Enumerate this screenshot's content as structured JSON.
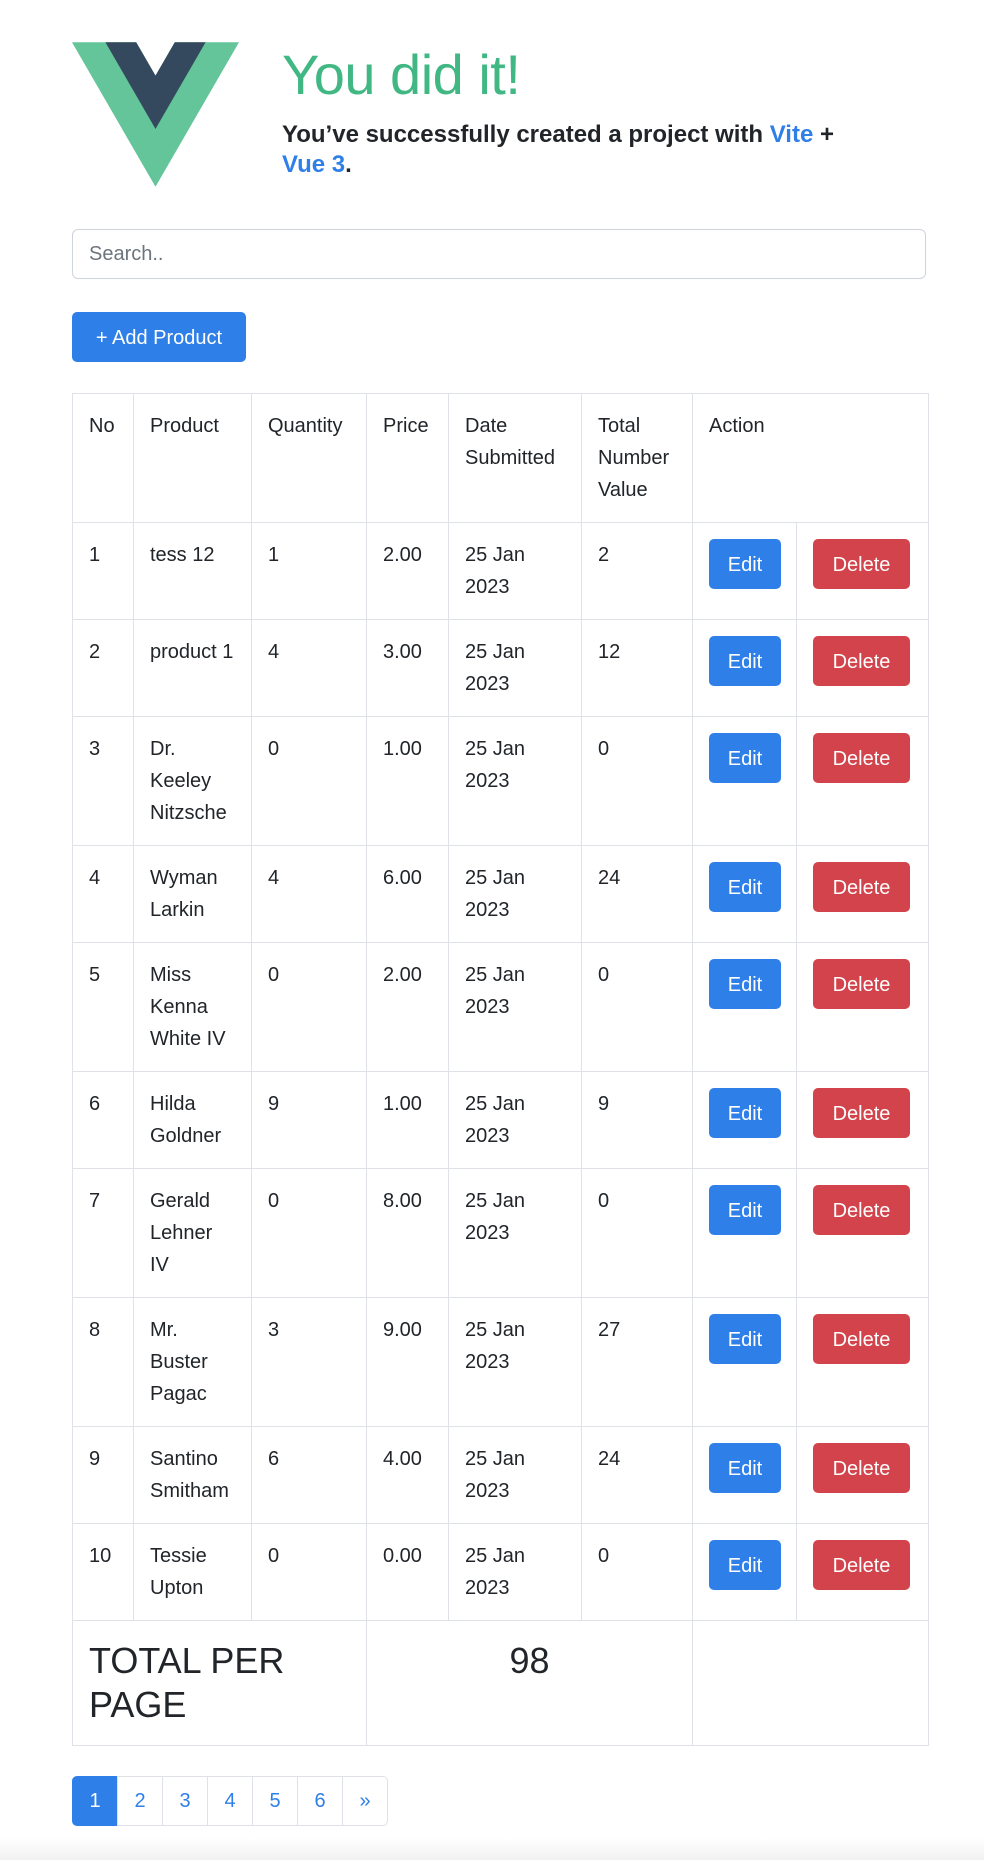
{
  "header": {
    "title": "You did it!",
    "subtitle_prefix": "You’ve successfully created a project with ",
    "link_vite": "Vite",
    "subtitle_mid": " + ",
    "link_vue": "Vue 3",
    "subtitle_suffix": ".",
    "logo_icon": "vue-logo-icon",
    "colors": {
      "vue_green": "#41b883",
      "vue_dark": "#35495e"
    }
  },
  "search": {
    "placeholder": "Search..",
    "value": ""
  },
  "toolbar": {
    "add_label": "+ Add Product"
  },
  "table": {
    "columns": [
      "No",
      "Product",
      "Quantity",
      "Price",
      "Date Submitted",
      "Total Number Value",
      "Action"
    ],
    "rows": [
      {
        "no": "1",
        "product": "tess 12",
        "quantity": "1",
        "price": "2.00",
        "date": "25 Jan 2023",
        "total": "2",
        "edit": "Edit",
        "delete": "Delete"
      },
      {
        "no": "2",
        "product": "product 1",
        "quantity": "4",
        "price": "3.00",
        "date": "25 Jan 2023",
        "total": "12",
        "edit": "Edit",
        "delete": "Delete"
      },
      {
        "no": "3",
        "product": "Dr. Keeley Nitzsche",
        "quantity": "0",
        "price": "1.00",
        "date": "25 Jan 2023",
        "total": "0",
        "edit": "Edit",
        "delete": "Delete"
      },
      {
        "no": "4",
        "product": "Wyman Larkin",
        "quantity": "4",
        "price": "6.00",
        "date": "25 Jan 2023",
        "total": "24",
        "edit": "Edit",
        "delete": "Delete"
      },
      {
        "no": "5",
        "product": "Miss Kenna White IV",
        "quantity": "0",
        "price": "2.00",
        "date": "25 Jan 2023",
        "total": "0",
        "edit": "Edit",
        "delete": "Delete"
      },
      {
        "no": "6",
        "product": "Hilda Goldner",
        "quantity": "9",
        "price": "1.00",
        "date": "25 Jan 2023",
        "total": "9",
        "edit": "Edit",
        "delete": "Delete"
      },
      {
        "no": "7",
        "product": "Gerald Lehner IV",
        "quantity": "0",
        "price": "8.00",
        "date": "25 Jan 2023",
        "total": "0",
        "edit": "Edit",
        "delete": "Delete"
      },
      {
        "no": "8",
        "product": "Mr. Buster Pagac",
        "quantity": "3",
        "price": "9.00",
        "date": "25 Jan 2023",
        "total": "27",
        "edit": "Edit",
        "delete": "Delete"
      },
      {
        "no": "9",
        "product": "Santino Smitham",
        "quantity": "6",
        "price": "4.00",
        "date": "25 Jan 2023",
        "total": "24",
        "edit": "Edit",
        "delete": "Delete"
      },
      {
        "no": "10",
        "product": "Tessie Upton",
        "quantity": "0",
        "price": "0.00",
        "date": "25 Jan 2023",
        "total": "0",
        "edit": "Edit",
        "delete": "Delete"
      }
    ],
    "footer": {
      "label": "TOTAL PER PAGE",
      "value": "98"
    }
  },
  "pagination": {
    "pages": [
      "1",
      "2",
      "3",
      "4",
      "5",
      "6"
    ],
    "next": "»",
    "active": "1"
  },
  "colors": {
    "primary": "#2f7fe8",
    "danger": "#d2434b",
    "border": "#dee2e6"
  }
}
